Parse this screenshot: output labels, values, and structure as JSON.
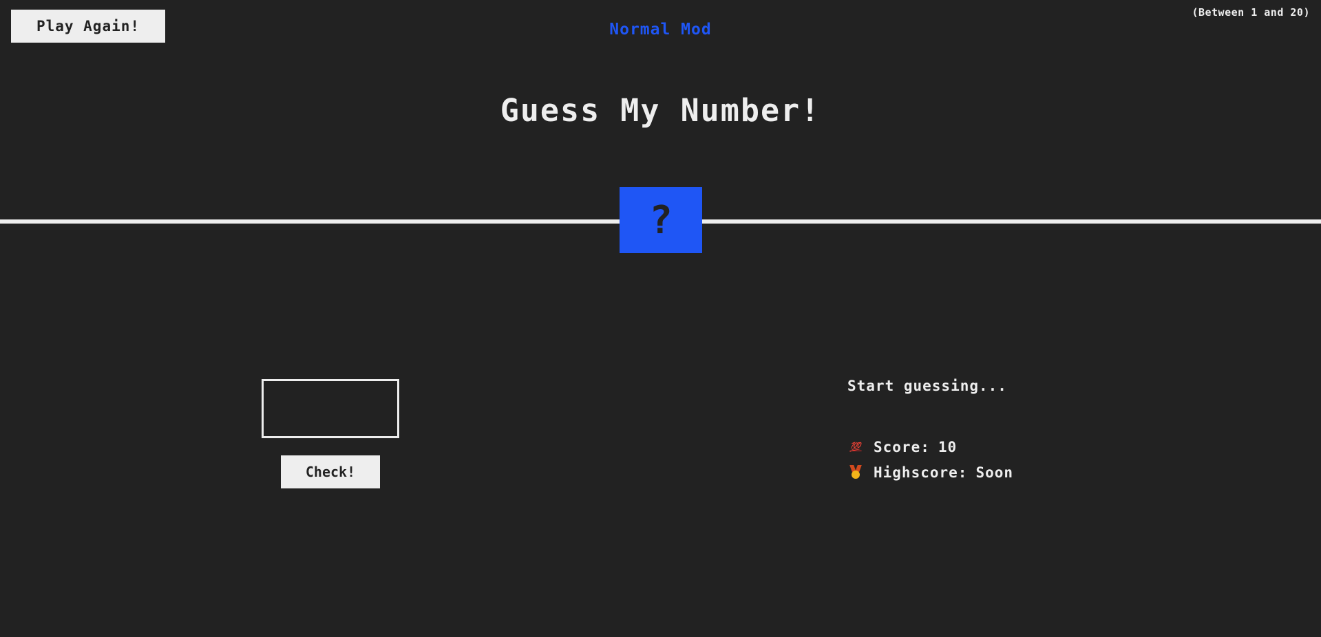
{
  "header": {
    "play_again_label": "Play Again!",
    "mode_label": "Normal Mod",
    "range_hint": "(Between 1 and 20)"
  },
  "main": {
    "title": "Guess My Number!",
    "secret_number_display": "?"
  },
  "left": {
    "guess_input_value": "",
    "check_label": "Check!"
  },
  "right": {
    "message": "Start guessing...",
    "score_icon": "💯",
    "score_label": "Score:",
    "score_value": "10",
    "highscore_icon": "medal-icon",
    "highscore_label": "Highscore:",
    "highscore_value": "Soon"
  },
  "colors": {
    "background": "#222222",
    "foreground": "#eeeeee",
    "accent": "#1f56f5"
  }
}
